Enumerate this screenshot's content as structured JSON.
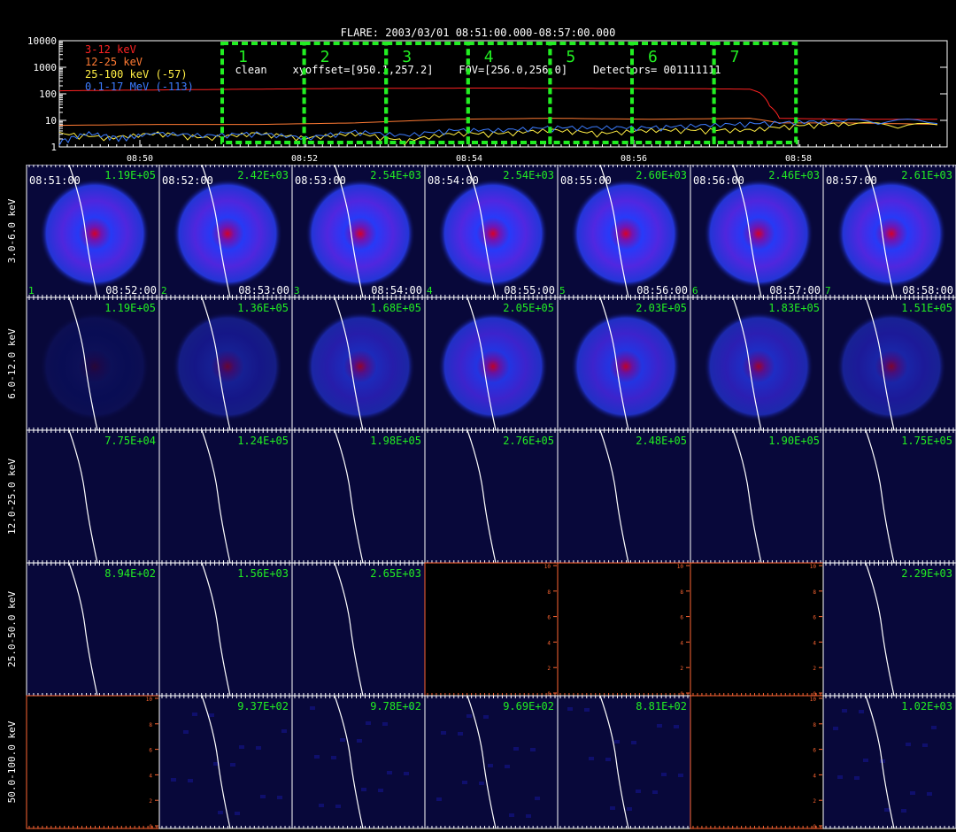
{
  "header": {
    "line1": "FLARE: 2003/03/01 08:51:00.000-08:57:00.000",
    "line2": "clean    xyoffset=[950.1,257.2]    FOV=[256.0,256.0]    Detectors= 001111111"
  },
  "colors": {
    "background": "#000000",
    "panel": "#08083a",
    "green": "#22ee22",
    "red": "#ff2222",
    "orange": "#ff7a33",
    "yellow": "#ffee44",
    "blue": "#3c7cff",
    "axis": "#ff6633"
  },
  "chart_data": [
    {
      "type": "line",
      "ylog": true,
      "ytick_labels": [
        "1",
        "10",
        "100",
        "1000",
        "10000"
      ],
      "xtick_labels": [
        "08:50",
        "08:52",
        "08:54",
        "08:56",
        "08:58"
      ],
      "legend": [
        "3-12 keV",
        "12-25 keV",
        "25-100 keV (-57)",
        "0.1-17 MeV (-113)"
      ],
      "legend_position": "top-left",
      "series": [
        {
          "name": "3-12 keV",
          "color": "#ff2222",
          "points": [
            [
              0,
              130
            ],
            [
              0.5,
              135
            ],
            [
              1,
              140
            ],
            [
              1.5,
              145
            ],
            [
              2,
              150
            ],
            [
              2.5,
              155
            ],
            [
              3,
              160
            ],
            [
              3.5,
              162
            ],
            [
              4,
              164
            ],
            [
              4.5,
              165
            ],
            [
              5,
              163
            ],
            [
              5.5,
              160
            ],
            [
              6,
              157
            ],
            [
              6.5,
              155
            ],
            [
              7,
              150
            ],
            [
              7.1,
              110
            ],
            [
              7.2,
              35
            ],
            [
              7.3,
              12
            ],
            [
              8,
              11
            ],
            [
              9,
              11
            ]
          ]
        },
        {
          "name": "12-25 keV",
          "color": "#ff7a33",
          "points": [
            [
              0,
              6.5
            ],
            [
              1,
              7
            ],
            [
              2,
              7
            ],
            [
              3,
              8
            ],
            [
              4,
              11
            ],
            [
              5,
              12
            ],
            [
              6,
              11
            ],
            [
              7,
              12
            ],
            [
              7.3,
              8
            ],
            [
              8,
              8
            ],
            [
              9,
              7
            ]
          ]
        },
        {
          "name": "25-100 keV (-57)",
          "color": "#ffee44",
          "points": [
            [
              0,
              3
            ],
            [
              0.5,
              2
            ],
            [
              1,
              3
            ],
            [
              1.5,
              2
            ],
            [
              2,
              3
            ],
            [
              2.5,
              2
            ],
            [
              3,
              3
            ],
            [
              3.5,
              1.5
            ],
            [
              4,
              3
            ],
            [
              4.5,
              3
            ],
            [
              5,
              4
            ],
            [
              5.5,
              3
            ],
            [
              6,
              4
            ],
            [
              6.5,
              4
            ],
            [
              7,
              4
            ],
            [
              7.5,
              6
            ],
            [
              8,
              7
            ],
            [
              9,
              6
            ]
          ]
        },
        {
          "name": "0.1-17 MeV (-113)",
          "color": "#3c7cff",
          "points": [
            [
              0,
              1.4
            ],
            [
              0.3,
              3
            ],
            [
              0.6,
              2
            ],
            [
              1,
              3
            ],
            [
              1.5,
              2.5
            ],
            [
              2,
              3
            ],
            [
              2.5,
              2
            ],
            [
              3,
              3.5
            ],
            [
              3.5,
              2.5
            ],
            [
              4,
              4
            ],
            [
              4.5,
              4
            ],
            [
              5,
              5
            ],
            [
              5.5,
              5
            ],
            [
              6,
              5
            ],
            [
              6.5,
              6
            ],
            [
              7,
              7
            ],
            [
              7.5,
              8
            ],
            [
              8,
              9
            ],
            [
              9,
              9
            ]
          ]
        }
      ],
      "intervals": [
        "1",
        "2",
        "3",
        "4",
        "5",
        "6",
        "7"
      ]
    },
    {
      "type": "heatmap",
      "energy_bands": [
        "3.0-6.0 keV",
        "6.0-12.0 keV",
        "12.0-25.0 keV",
        "25.0-50.0 keV",
        "50.0-100.0 keV"
      ],
      "start_times": [
        "08:51:00",
        "08:52:00",
        "08:53:00",
        "08:54:00",
        "08:55:00",
        "08:56:00",
        "08:57:00"
      ],
      "end_times": [
        "08:52:00",
        "08:53:00",
        "08:54:00",
        "08:55:00",
        "08:56:00",
        "08:57:00",
        "08:58:00"
      ],
      "interval_numbers": [
        "1",
        "2",
        "3",
        "4",
        "5",
        "6",
        "7"
      ],
      "max_values": [
        [
          "1.19E+05",
          "2.42E+03",
          "2.54E+03",
          "2.54E+03",
          "2.60E+03",
          "2.46E+03",
          "2.61E+03"
        ],
        [
          "1.19E+05",
          "1.36E+05",
          "1.68E+05",
          "2.05E+05",
          "2.03E+05",
          "1.83E+05",
          "1.51E+05"
        ],
        [
          "7.75E+04",
          "1.24E+05",
          "1.98E+05",
          "2.76E+05",
          "2.48E+05",
          "1.90E+05",
          "1.75E+05"
        ],
        [
          "8.94E+02",
          "1.56E+03",
          "2.65E+03",
          "",
          "",
          "",
          "2.29E+03"
        ],
        [
          "",
          "9.37E+02",
          "9.78E+02",
          "9.69E+02",
          "8.81E+02",
          "",
          "1.02E+03"
        ]
      ],
      "brightness": [
        [
          0.95,
          0.95,
          0.96,
          0.97,
          0.97,
          0.95,
          0.96
        ],
        [
          0.15,
          0.45,
          0.65,
          0.85,
          0.85,
          0.7,
          0.55
        ],
        [
          0,
          0,
          0,
          0,
          0,
          0,
          0
        ],
        [
          0,
          0,
          0,
          null,
          null,
          null,
          0
        ],
        [
          null,
          0.05,
          0.08,
          0.05,
          0.05,
          null,
          0.08
        ]
      ],
      "empty_axis_ticks": [
        "0",
        "2",
        "4",
        "6",
        "8",
        "10"
      ]
    }
  ]
}
